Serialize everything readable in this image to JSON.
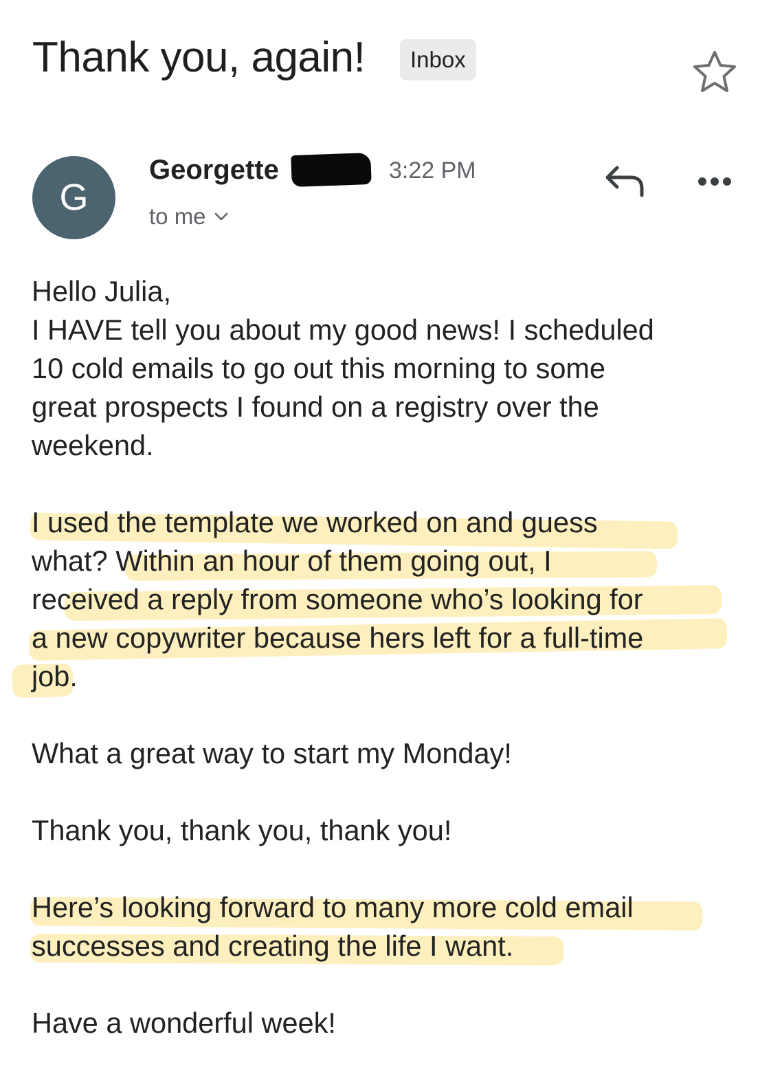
{
  "email": {
    "subject": "Thank you, again!",
    "label": "Inbox",
    "sender": {
      "initial": "G",
      "name": "Georgette",
      "time": "3:22 PM",
      "recipient": "to me"
    },
    "body_lines": [
      "Hello Julia,",
      "I HAVE tell you about my good news! I scheduled",
      "10 cold emails to go out this morning to some",
      "great prospects I found on a registry over the",
      "weekend.",
      "I used the template we worked on and guess",
      "what? Within an hour of them going out, I",
      "received a reply from someone who’s looking for",
      "a new copywriter because hers left for a full-time",
      "job.",
      "What a great way to start my Monday!",
      "Thank you, thank you, thank you!",
      "Here’s looking forward to many more cold email",
      "successes and creating the life I want.",
      "Have a wonderful week!"
    ]
  },
  "icons": {
    "star": "star-outline-icon",
    "reply": "reply-icon",
    "more": "more-horizontal-icon",
    "expand": "chevron-down-icon"
  },
  "colors": {
    "avatar_bg": "#4c6370",
    "highlight": "#fce9a8",
    "label_chip_bg": "#ebebeb",
    "secondary_text": "#5f6368"
  }
}
